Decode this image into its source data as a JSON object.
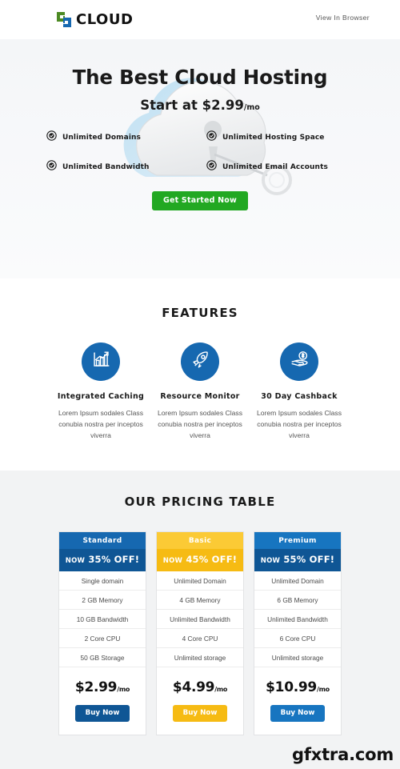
{
  "header": {
    "logo_text": "CLOUD",
    "logo_icon": "cloud-brand-mark",
    "view_in_browser": "View In Browser"
  },
  "hero": {
    "headline": "The Best Cloud Hosting",
    "subheadline_prefix": "Start at $2.99",
    "subheadline_suffix": "/mo",
    "bullets": [
      {
        "label": "Unlimited Domains",
        "icon": "check-circle-icon"
      },
      {
        "label": "Unlimited Hosting  Space",
        "icon": "check-circle-icon"
      },
      {
        "label": "Unlimited Bandwidth",
        "icon": "check-circle-icon"
      },
      {
        "label": "Unlimited Email Accounts",
        "icon": "check-circle-icon"
      }
    ],
    "cta_label": "Get Started Now",
    "cta_color": "#22a822",
    "background_art": "cloud-with-keyhole-and-key"
  },
  "features": {
    "title": "FEATURES",
    "accent_color": "#1668b0",
    "items": [
      {
        "icon": "bar-chart-growth-icon",
        "title": "Integrated Caching",
        "desc": "Lorem Ipsum sodales Class conubia nostra per inceptos viverra"
      },
      {
        "icon": "rocket-icon",
        "title": "Resource Monitor",
        "desc": "Lorem Ipsum sodales Class conubia nostra per inceptos viverra"
      },
      {
        "icon": "hand-holding-dollar-icon",
        "title": "30 Day Cashback",
        "desc": "Lorem Ipsum sodales Class conubia nostra per inceptos viverra"
      }
    ]
  },
  "pricing": {
    "title": "OUR PRICING TABLE",
    "plans": [
      {
        "name": "Standard",
        "discount_prefix": "NOW",
        "discount": " 35% OFF!",
        "head_color": "#1668b0",
        "band_color": "#0f5695",
        "button_color": "#0f5695",
        "features": [
          "Single domain",
          "2 GB Memory",
          "10 GB Bandwidth",
          "2 Core CPU",
          "50 GB Storage"
        ],
        "price": "$2.99",
        "price_period": "/mo",
        "buy_label": "Buy Now"
      },
      {
        "name": "Basic",
        "discount_prefix": "NOW",
        "discount": " 45% OFF!",
        "head_color": "#fbca35",
        "band_color": "#f6bb13",
        "button_color": "#f6bb13",
        "features": [
          "Unlimited Domain",
          "4 GB Memory",
          "Unlimited Bandwidth",
          "4 Core CPU",
          "Unlimited storage"
        ],
        "price": "$4.99",
        "price_period": "/mo",
        "buy_label": "Buy Now"
      },
      {
        "name": "Premium",
        "discount_prefix": "NOW",
        "discount": " 55% OFF!",
        "head_color": "#1775c0",
        "band_color": "#0f5695",
        "button_color": "#1775c0",
        "features": [
          "Unlimited Domain",
          "6 GB Memory",
          "Unlimited Bandwidth",
          "6 Core CPU",
          "Unlimited storage"
        ],
        "price": "$10.99",
        "price_period": "/mo",
        "buy_label": "Buy Now"
      }
    ]
  },
  "watermark": {
    "overlay_text": "GFXTRA",
    "footer_text": "gfxtra.com"
  }
}
